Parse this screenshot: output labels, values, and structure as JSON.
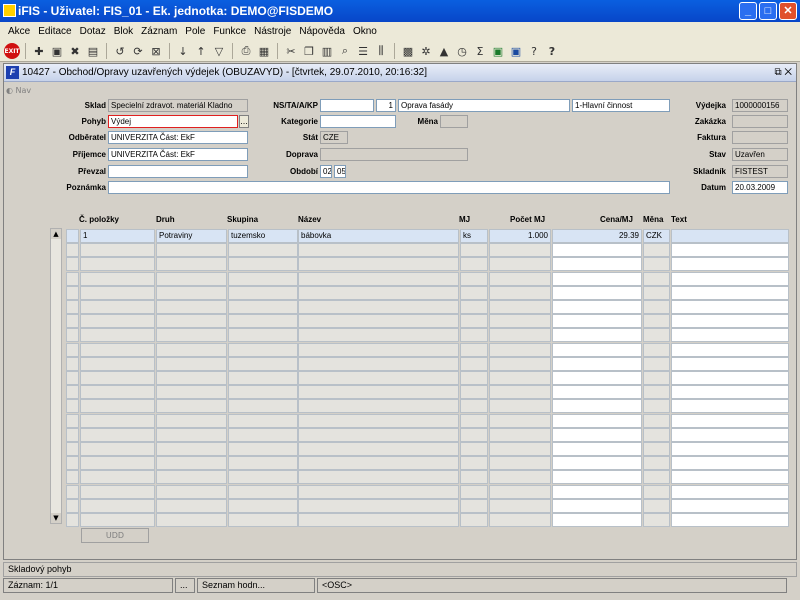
{
  "window": {
    "title": "iFIS - Uživatel: FIS_01 - Ek. jednotka: DEMO@FISDEMO"
  },
  "menu": [
    "Akce",
    "Editace",
    "Dotaz",
    "Blok",
    "Záznam",
    "Pole",
    "Funkce",
    "Nástroje",
    "Nápověda",
    "Okno"
  ],
  "toolbar": {
    "exit_label": "EXIT",
    "icons": [
      "add-record-icon",
      "save-icon",
      "delete-record-icon",
      "document-icon",
      "undo-icon",
      "refresh-icon",
      "delete-icon",
      "sort-asc-icon",
      "sort-desc-icon",
      "filter-icon",
      "print-icon",
      "print-preview-icon",
      "cut-icon",
      "copy-icon",
      "paste-icon",
      "find-icon",
      "list-icon",
      "columns-icon",
      "calculator-icon",
      "settings-icon",
      "chart-icon",
      "clock-icon",
      "sum-icon",
      "excel-icon",
      "word-icon",
      "help-icon",
      "about-icon"
    ]
  },
  "form": {
    "title": "10427 - Obchod/Opravy uzavřených výdejek (OBUZAVYD) - [čtvrtek, 29.07.2010, 20:16:32]",
    "nav_label": "Nav",
    "fields": {
      "sklad": {
        "label": "Sklad",
        "value": "Specielní zdravot. materiál Kladno"
      },
      "pohyb": {
        "label": "Pohyb",
        "value": "Výdej"
      },
      "odberatel": {
        "label": "Odběratel",
        "value": "UNIVERZITA Část: EkF"
      },
      "prijemce": {
        "label": "Příjemce",
        "value": "UNIVERZITA Část: EkF"
      },
      "prevzal": {
        "label": "Převzal",
        "value": ""
      },
      "poznamka": {
        "label": "Poznámka",
        "value": ""
      },
      "nstaakp": {
        "label": "NS/TA/A/KP",
        "value1": "",
        "value2": "1",
        "value3": "Oprava fasády",
        "value4": "1-Hlavní činnost"
      },
      "kategorie": {
        "label": "Kategorie",
        "value": ""
      },
      "mena": {
        "label": "Měna",
        "value": ""
      },
      "stat": {
        "label": "Stát",
        "value": "CZE"
      },
      "doprava": {
        "label": "Doprava",
        "value": ""
      },
      "obdobi": {
        "label": "Období",
        "value1": "02",
        "value2": "05"
      },
      "vydejka": {
        "label": "Výdejka",
        "value": "1000000156"
      },
      "zakazka": {
        "label": "Zakázka",
        "value": ""
      },
      "faktura": {
        "label": "Faktura",
        "value": ""
      },
      "stav": {
        "label": "Stav",
        "value": "Uzavřen"
      },
      "skladnik": {
        "label": "Skladník",
        "value": "FISTEST"
      },
      "datum": {
        "label": "Datum",
        "value": "20.03.2009"
      }
    },
    "lov_symbol": "...",
    "grid": {
      "columns": [
        "Č. položky",
        "Druh",
        "Skupina",
        "Název",
        "MJ",
        "Počet MJ",
        "Cena/MJ",
        "Měna",
        "Text"
      ],
      "rows": [
        {
          "cislo": "1",
          "druh": "Potraviny",
          "skupina": "tuzemsko",
          "nazev": "bábovka",
          "mj": "ks",
          "pocet": "1.000",
          "cena": "29.39",
          "mena": "CZK",
          "text": ""
        }
      ]
    },
    "udd_button": "UDD"
  },
  "status": {
    "line1": "Skladový pohyb",
    "zaznam": "Záznam: 1/1",
    "seg2": "...",
    "seznam": "Seznam hodn...",
    "osc": "<OSC>"
  }
}
